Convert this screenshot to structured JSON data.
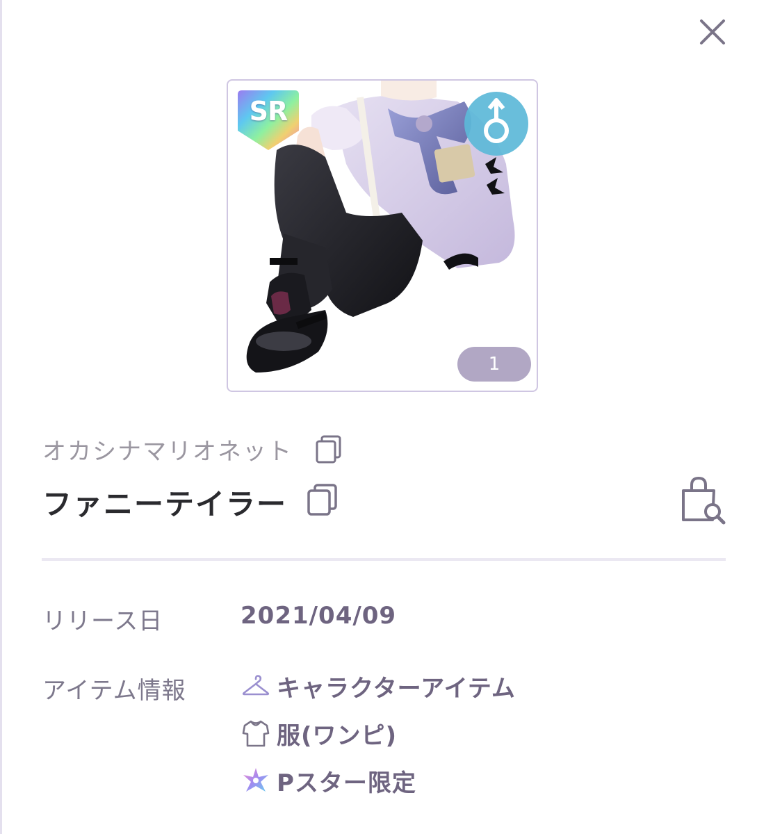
{
  "item": {
    "rarity": "SR",
    "count": "1",
    "series_name": "オカシナマリオネット",
    "name": "ファニーテイラー"
  },
  "details": {
    "release_label": "リリース日",
    "release_date": "2021/04/09",
    "info_label": "アイテム情報",
    "tags": [
      {
        "icon": "hanger-icon",
        "label": "キャラクターアイテム"
      },
      {
        "icon": "dress-icon",
        "label": "服(ワンピ)"
      },
      {
        "icon": "pstar-icon",
        "label": "Pスター限定"
      }
    ]
  },
  "colors": {
    "accent": "#6e6480",
    "label": "#7d788c",
    "card_border": "#cfc6e2",
    "count_pill": "#b1a7c4",
    "gender_badge": "#5cb8d8"
  }
}
